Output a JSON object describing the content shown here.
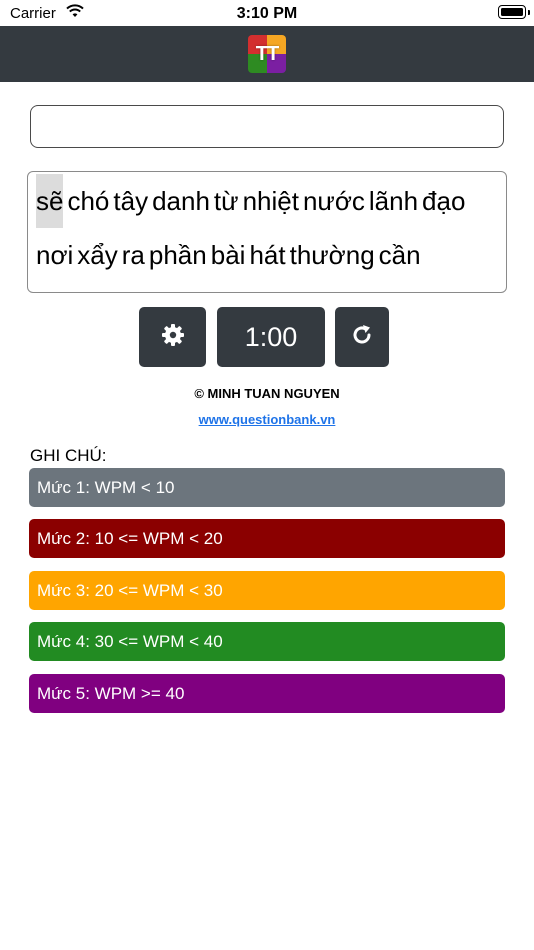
{
  "status_bar": {
    "carrier": "Carrier",
    "time": "3:10 PM"
  },
  "header": {
    "logo_text": "TT",
    "logo_colors": [
      "#d32f2f",
      "#f5a623",
      "#2e8b22",
      "#7b1fa2"
    ]
  },
  "typing_input": {
    "value": "",
    "placeholder": ""
  },
  "words": [
    "sẽ",
    "chó",
    "tây",
    "danh",
    "từ",
    "nhiệt",
    "nước",
    "lãnh",
    "đạo",
    "nơi",
    "xẩy",
    "ra",
    "phần",
    "bài",
    "hát",
    "thường",
    "cần"
  ],
  "current_word_index": 0,
  "controls": {
    "settings_icon": "gear-icon",
    "timer": "1:00",
    "reset_icon": "refresh-icon"
  },
  "credit": "© MINH TUAN NGUYEN",
  "link": "www.questionbank.vn",
  "notes": {
    "heading": "GHI CHÚ:",
    "levels": [
      {
        "label": "Mức 1: WPM < 10",
        "color": "#6c757d"
      },
      {
        "label": "Mức 2: 10 <= WPM < 20",
        "color": "#8b0000"
      },
      {
        "label": "Mức 3: 20 <= WPM < 30",
        "color": "#ffa500"
      },
      {
        "label": "Mức 4: 30 <= WPM < 40",
        "color": "#228b22"
      },
      {
        "label": "Mức 5: WPM >= 40",
        "color": "#800080"
      }
    ]
  }
}
